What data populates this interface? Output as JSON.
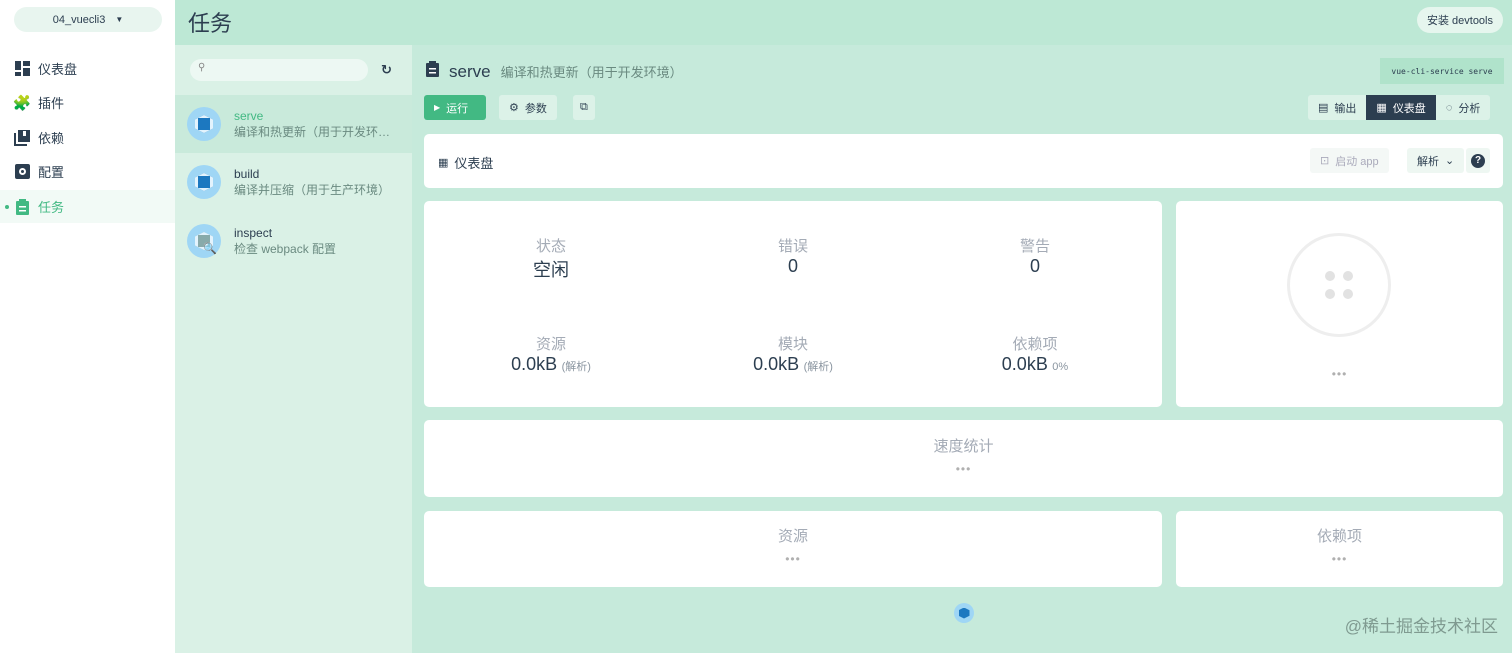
{
  "sidebar": {
    "project": "04_vuecli3",
    "items": [
      {
        "label": "仪表盘",
        "icon": "dashboard-icon"
      },
      {
        "label": "插件",
        "icon": "puzzle-icon"
      },
      {
        "label": "依赖",
        "icon": "library-icon"
      },
      {
        "label": "配置",
        "icon": "settings-icon"
      },
      {
        "label": "任务",
        "icon": "clipboard-icon"
      }
    ]
  },
  "header": {
    "title": "任务",
    "devtools": "安装 devtools"
  },
  "tasks": [
    {
      "name": "serve",
      "desc": "编译和热更新（用于开发环境）"
    },
    {
      "name": "build",
      "desc": "编译并压缩（用于生产环境）"
    },
    {
      "name": "inspect",
      "desc": "检查 webpack 配置"
    }
  ],
  "task": {
    "name": "serve",
    "desc": "编译和热更新（用于开发环境）",
    "command": "vue-cli-service serve",
    "run": "运行",
    "params": "参数",
    "views": {
      "output": "输出",
      "dashboard": "仪表盘",
      "analyze": "分析"
    }
  },
  "dashboard": {
    "title": "仪表盘",
    "start_app": "启动 app",
    "mode": "解析",
    "help": "?"
  },
  "stats": {
    "status_label": "状态",
    "status": "空闲",
    "errors_label": "错误",
    "errors": "0",
    "warnings_label": "警告",
    "warnings": "0",
    "assets_label": "资源",
    "assets": "0.0kB",
    "assets_note": "(解析)",
    "modules_label": "模块",
    "modules": "0.0kB",
    "modules_note": "(解析)",
    "deps_label": "依赖项",
    "deps": "0.0kB",
    "deps_pct": "0%"
  },
  "panels": {
    "speed": "速度统计",
    "assets": "资源",
    "deps": "依赖项",
    "loading": "•••"
  },
  "watermark": "@稀土掘金技术社区",
  "colors": {
    "accent": "#42b983",
    "dark": "#2c3e50"
  }
}
